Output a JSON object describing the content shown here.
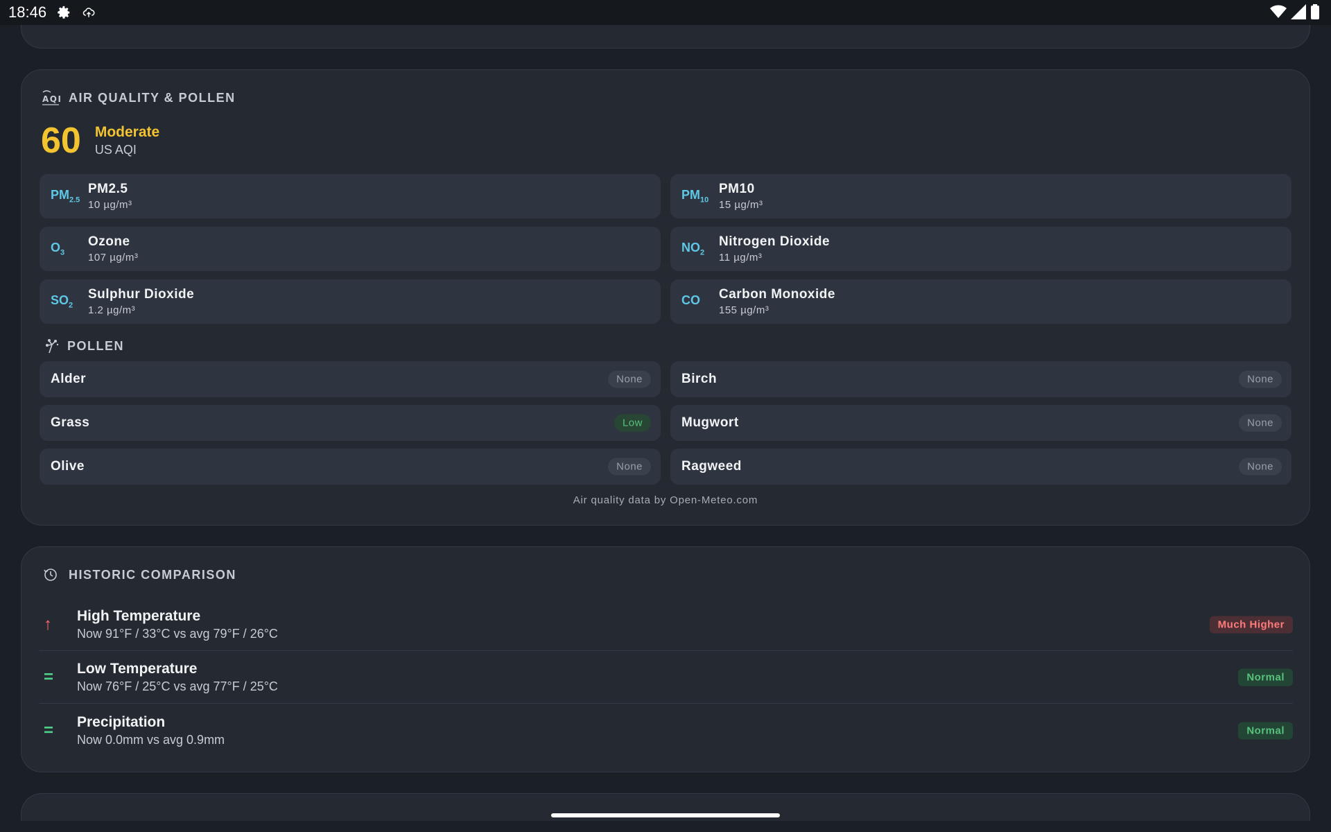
{
  "status_bar": {
    "time": "18:46",
    "icons": [
      "gear-icon",
      "cloud-upload-icon"
    ],
    "right_icons": [
      "wifi-icon",
      "signal-icon",
      "battery-icon"
    ]
  },
  "air_quality": {
    "title": "AIR QUALITY & POLLEN",
    "icon": "aqi-icon",
    "aqi_value": "60",
    "aqi_level": "Moderate",
    "aqi_scale": "US AQI",
    "aqi_color": "#f4c430",
    "pollutants": [
      {
        "symbol": "PM",
        "sub": "2.5",
        "name": "PM2.5",
        "value": "10 µg/m³"
      },
      {
        "symbol": "PM",
        "sub": "10",
        "name": "PM10",
        "value": "15 µg/m³"
      },
      {
        "symbol": "O",
        "sub": "3",
        "name": "Ozone",
        "value": "107 µg/m³"
      },
      {
        "symbol": "NO",
        "sub": "2",
        "name": "Nitrogen Dioxide",
        "value": "11 µg/m³"
      },
      {
        "symbol": "SO",
        "sub": "2",
        "name": "Sulphur Dioxide",
        "value": "1.2 µg/m³"
      },
      {
        "symbol": "CO",
        "sub": "",
        "name": "Carbon Monoxide",
        "value": "155 µg/m³"
      }
    ],
    "pollen_title": "POLLEN",
    "pollen_icon": "pollen-icon",
    "pollen": [
      {
        "name": "Alder",
        "level": "None"
      },
      {
        "name": "Birch",
        "level": "None"
      },
      {
        "name": "Grass",
        "level": "Low"
      },
      {
        "name": "Mugwort",
        "level": "None"
      },
      {
        "name": "Olive",
        "level": "None"
      },
      {
        "name": "Ragweed",
        "level": "None"
      }
    ],
    "footer": "Air quality data by Open-Meteo.com"
  },
  "historic": {
    "title": "HISTORIC COMPARISON",
    "icon": "history-icon",
    "rows": [
      {
        "trend": "↑",
        "title": "High Temperature",
        "detail": "Now 91°F / 33°C vs avg 79°F / 26°C",
        "badge": "Much Higher"
      },
      {
        "trend": "=",
        "title": "Low Temperature",
        "detail": "Now 76°F / 25°C vs avg 77°F / 25°C",
        "badge": "Normal"
      },
      {
        "trend": "=",
        "title": "Precipitation",
        "detail": "Now 0.0mm vs avg 0.9mm",
        "badge": "Normal"
      }
    ]
  }
}
